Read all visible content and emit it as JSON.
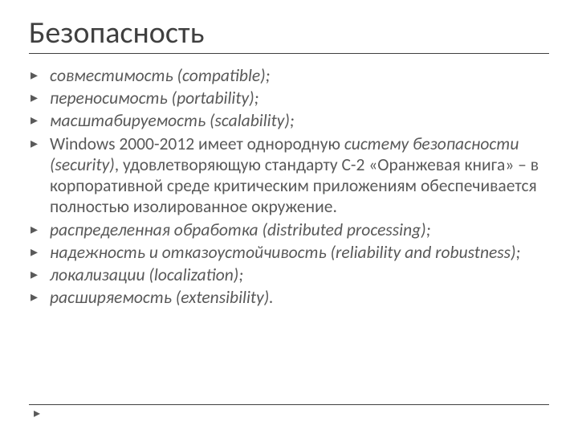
{
  "title": "Безопасность",
  "items": [
    {
      "html": "<span class='ital'>совместимость (compatible);</span>"
    },
    {
      "html": "<span class='ital'>переносимость (portability);</span>"
    },
    {
      "html": "<span class='ital'>масштабируемость (scalability);</span>"
    },
    {
      "html": "Windows 2000-2012 имеет однородную <span class='ital'>систему безопасности (security)</span>, удовлетворяющую стандарту С-2 «Оранжевая книга» – в корпоративной среде критическим приложениям обеспечивается полностью изолированное окружение."
    },
    {
      "html": "<span class='ital'>распределенная обработка (distributed processing);</span>"
    },
    {
      "html": "<span class='ital'>надежность и отказоустойчивость (reliability and robustness);</span>"
    },
    {
      "html": "<span class='ital'>локализации (localization);</span>"
    },
    {
      "html": "<span class='ital'>расширяемость (extensibility).</span>"
    }
  ],
  "footer_mark": "▸"
}
